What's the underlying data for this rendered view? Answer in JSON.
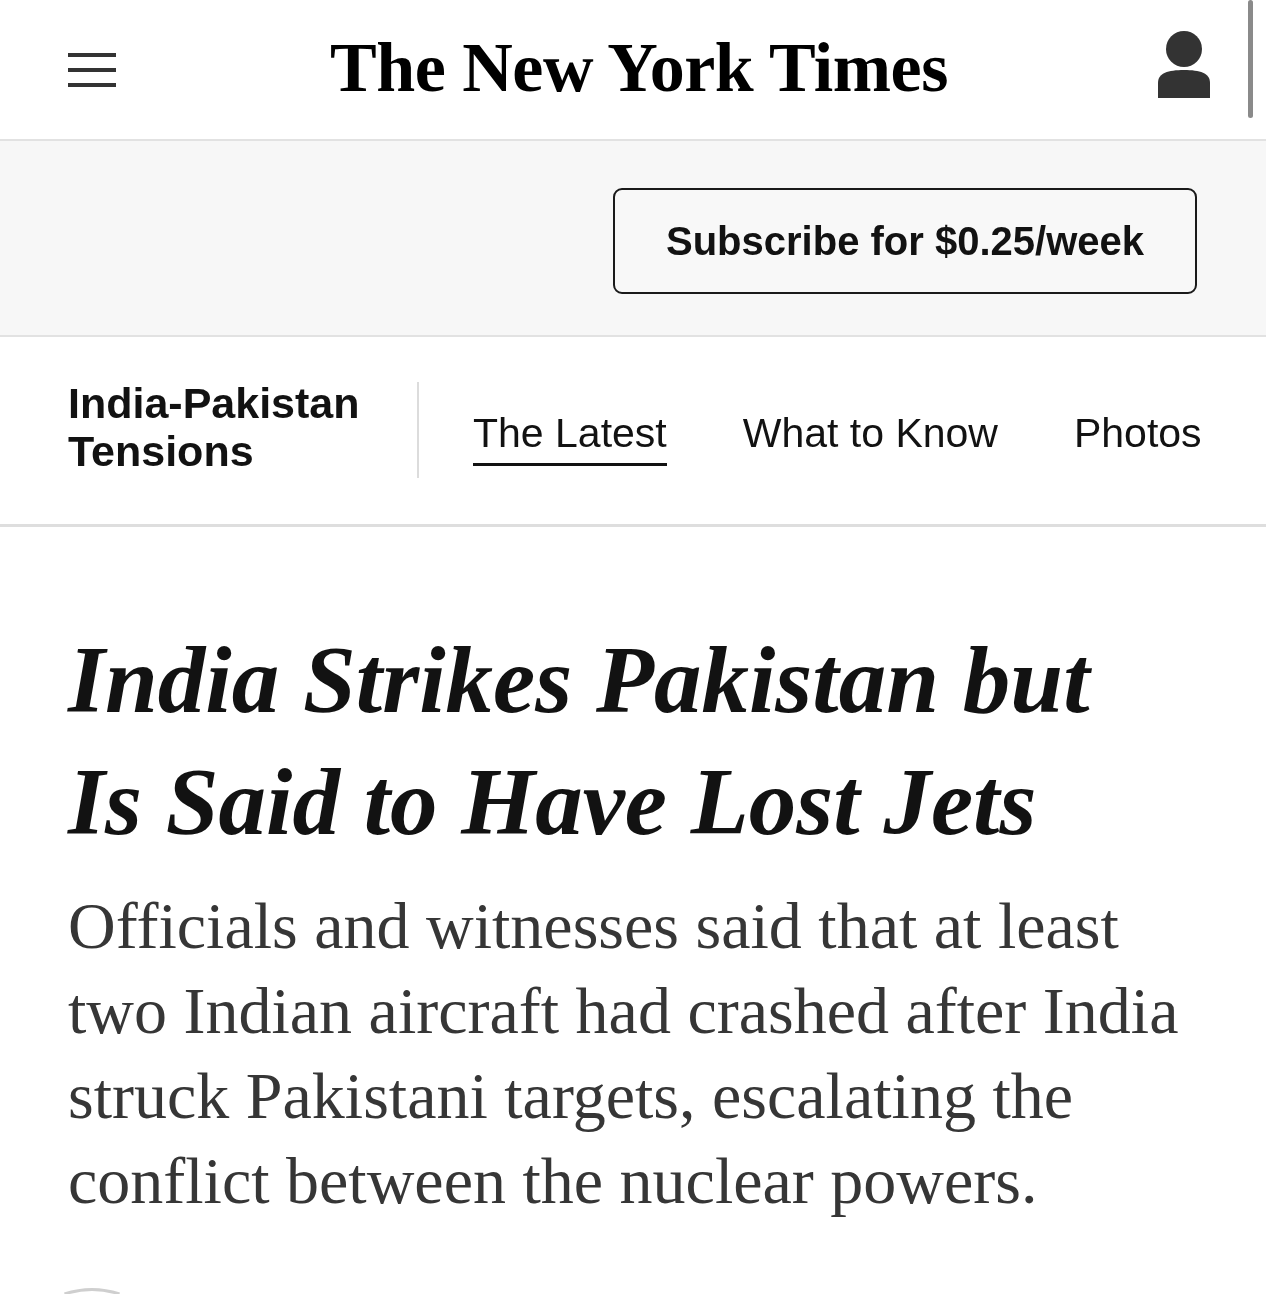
{
  "header": {
    "logo": "The New York Times"
  },
  "promo": {
    "subscribe_button": "Subscribe for $0.25/week"
  },
  "section_nav": {
    "title": "India-Pakistan Tensions",
    "tabs": [
      {
        "label": "The Latest",
        "selected": true
      },
      {
        "label": "What to Know",
        "selected": false
      },
      {
        "label": "Photos",
        "selected": false
      }
    ]
  },
  "article": {
    "headline": "India Strikes Pakistan but Is Said to Have Lost Jets",
    "summary": "Officials and witnesses said that at least two Indian aircraft had crashed after India struck Pakistani targets, escalating the conflict between the nuclear powers."
  }
}
